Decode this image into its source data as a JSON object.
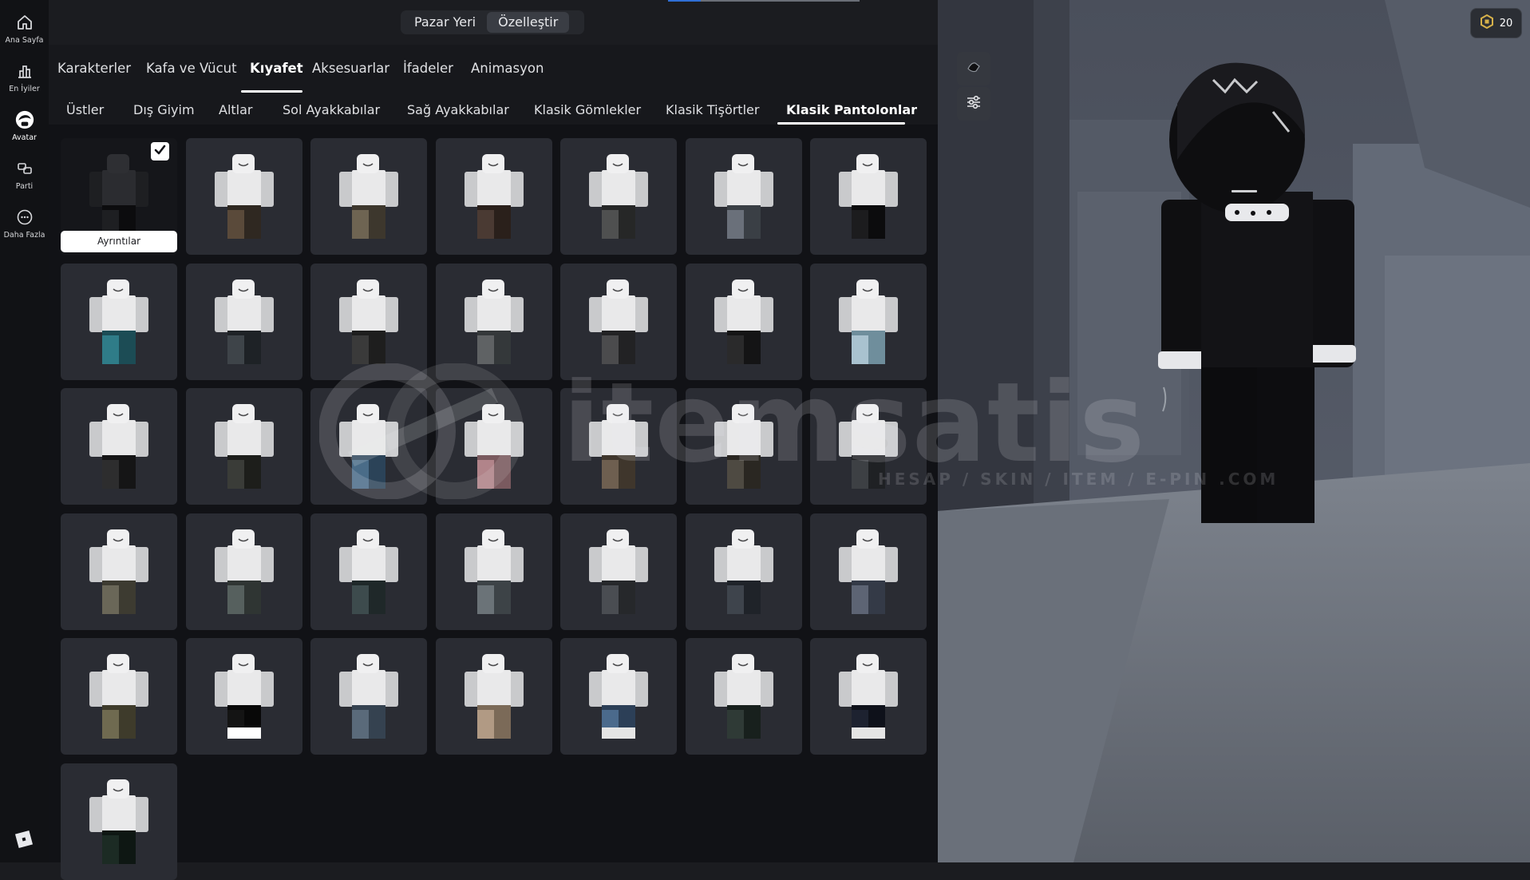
{
  "rail": {
    "items": [
      {
        "label": "Ana Sayfa",
        "icon": "home-icon"
      },
      {
        "label": "En İyiler",
        "icon": "chart-icon"
      },
      {
        "label": "Avatar",
        "icon": "avatar-icon",
        "active": true
      },
      {
        "label": "Parti",
        "icon": "party-icon"
      },
      {
        "label": "Daha Fazla",
        "icon": "more-icon"
      }
    ],
    "logo_icon": "roblox-logo-icon"
  },
  "mode_switch": {
    "marketplace": "Pazar Yeri",
    "customize": "Özelleştir",
    "selected": "Özelleştir"
  },
  "categories": {
    "tabs": [
      "Karakterler",
      "Kafa ve Vücut",
      "Kıyafet",
      "Aksesuarlar",
      "İfadeler",
      "Animasyon"
    ],
    "active": "Kıyafet"
  },
  "subcategories": {
    "tabs": [
      "Üstler",
      "Dış Giyim",
      "Altlar",
      "Sol Ayakkabılar",
      "Sağ Ayakkabılar",
      "Klasik Gömlekler",
      "Klasik Tişörtler",
      "Klasik Pantolonlar"
    ],
    "active": "Klasik Pantolonlar"
  },
  "grid": {
    "details_label": "Ayrıntılar",
    "equipped_index": 0,
    "items": [
      {
        "pants": "#1e1f22",
        "shade": "#0c0c0e",
        "equipped": true
      },
      {
        "pants": "#5a4a3a",
        "shade": "#2f2821"
      },
      {
        "pants": "#6e6452",
        "shade": "#3d372d"
      },
      {
        "pants": "#4a3a33",
        "shade": "#2a201b"
      },
      {
        "pants": "#4f5050",
        "shade": "#262727"
      },
      {
        "pants": "#6a707a",
        "shade": "#3a3f45"
      },
      {
        "pants": "#1c1c1e",
        "shade": "#0c0c0d"
      },
      {
        "pants": "#2f7c88",
        "shade": "#1c4c55"
      },
      {
        "pants": "#3e4449",
        "shade": "#1e2226"
      },
      {
        "pants": "#3a3a3a",
        "shade": "#1e1e1e"
      },
      {
        "pants": "#5f6264",
        "shade": "#34383a"
      },
      {
        "pants": "#4b4b4d",
        "shade": "#222224"
      },
      {
        "pants": "#2a2a2b",
        "shade": "#141415"
      },
      {
        "pants": "#a9c2cf",
        "shade": "#6f8e9c"
      },
      {
        "pants": "#2d2d2e",
        "shade": "#151516"
      },
      {
        "pants": "#3a3c38",
        "shade": "#1d1e1b"
      },
      {
        "pants": "#4a6c88",
        "shade": "#2b4358"
      },
      {
        "pants": "#b1848a",
        "shade": "#7a5a5f"
      },
      {
        "pants": "#6e5f50",
        "shade": "#3f362c"
      },
      {
        "pants": "#4e4a42",
        "shade": "#2a2722"
      },
      {
        "pants": "#3d4044",
        "shade": "#1f2124"
      },
      {
        "pants": "#6a6758",
        "shade": "#3d3b31"
      },
      {
        "pants": "#56605e",
        "shade": "#2f3533"
      },
      {
        "pants": "#3d4b4d",
        "shade": "#1f2829"
      },
      {
        "pants": "#6b7378",
        "shade": "#3d4347"
      },
      {
        "pants": "#4a4d52",
        "shade": "#26282b"
      },
      {
        "pants": "#3e444c",
        "shade": "#1f2329"
      },
      {
        "pants": "#5d6474",
        "shade": "#343a47"
      },
      {
        "pants": "#6f6a50",
        "shade": "#3e3b2b"
      },
      {
        "pants": "#141414",
        "shade": "#080808",
        "band": "#ffffff"
      },
      {
        "pants": "#5a6a7a",
        "shade": "#354250"
      },
      {
        "pants": "#b19a84",
        "shade": "#7b6a58"
      },
      {
        "pants": "#4b6a8c",
        "shade": "#2c3f57",
        "band": "#e5e5e5"
      },
      {
        "pants": "#2f3a36",
        "shade": "#18201d"
      },
      {
        "pants": "#1d2230",
        "shade": "#0e111a",
        "band": "#e5e5e5"
      },
      {
        "pants": "#1c2b24",
        "shade": "#0e1713"
      }
    ]
  },
  "viewport": {
    "tools": [
      {
        "icon": "hand-pose-icon"
      },
      {
        "icon": "sliders-icon"
      }
    ],
    "robux_icon": "robux-icon",
    "robux_count": "20",
    "loading_progress": 0.17
  },
  "watermark": {
    "text": "itemsatis",
    "tagline": "HESAP / SKIN / ITEM / E-PIN .COM"
  },
  "colors": {
    "panel_bg": "#111216",
    "tile_bg": "#2a2c33",
    "active_text": "#ffffff",
    "accent_blue": "#2f6fd6"
  }
}
